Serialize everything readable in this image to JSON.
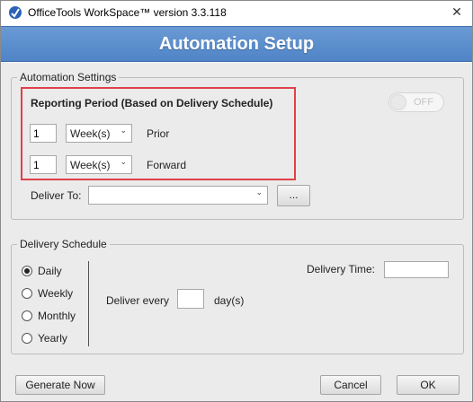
{
  "window": {
    "title": "OfficeTools WorkSpace™ version 3.3.118",
    "close_glyph": "✕"
  },
  "header": {
    "title": "Automation Setup"
  },
  "automation_settings": {
    "legend": "Automation Settings",
    "reporting_period_label": "Reporting Period (Based on Delivery Schedule)",
    "toggle_label": "OFF",
    "prior": {
      "value": "1",
      "unit": "Week(s)",
      "label": "Prior"
    },
    "forward": {
      "value": "1",
      "unit": "Week(s)",
      "label": "Forward"
    },
    "deliver_to_label": "Deliver To:",
    "deliver_to_value": "",
    "browse_label": "..."
  },
  "delivery_schedule": {
    "legend": "Delivery Schedule",
    "options": [
      {
        "label": "Daily",
        "checked": true
      },
      {
        "label": "Weekly",
        "checked": false
      },
      {
        "label": "Monthly",
        "checked": false
      },
      {
        "label": "Yearly",
        "checked": false
      }
    ],
    "deliver_every_label": "Deliver every",
    "deliver_every_value": "",
    "days_label": "day(s)",
    "delivery_time_label": "Delivery Time:",
    "delivery_time_value": ""
  },
  "footer": {
    "generate_label": "Generate Now",
    "cancel_label": "Cancel",
    "ok_label": "OK"
  },
  "colors": {
    "header_blue": "#5a8ccc",
    "highlight_red": "#e0404a"
  },
  "icons": {
    "app": "officetools-logo-icon",
    "close": "close-icon",
    "chevron": "chevron-down-icon"
  }
}
